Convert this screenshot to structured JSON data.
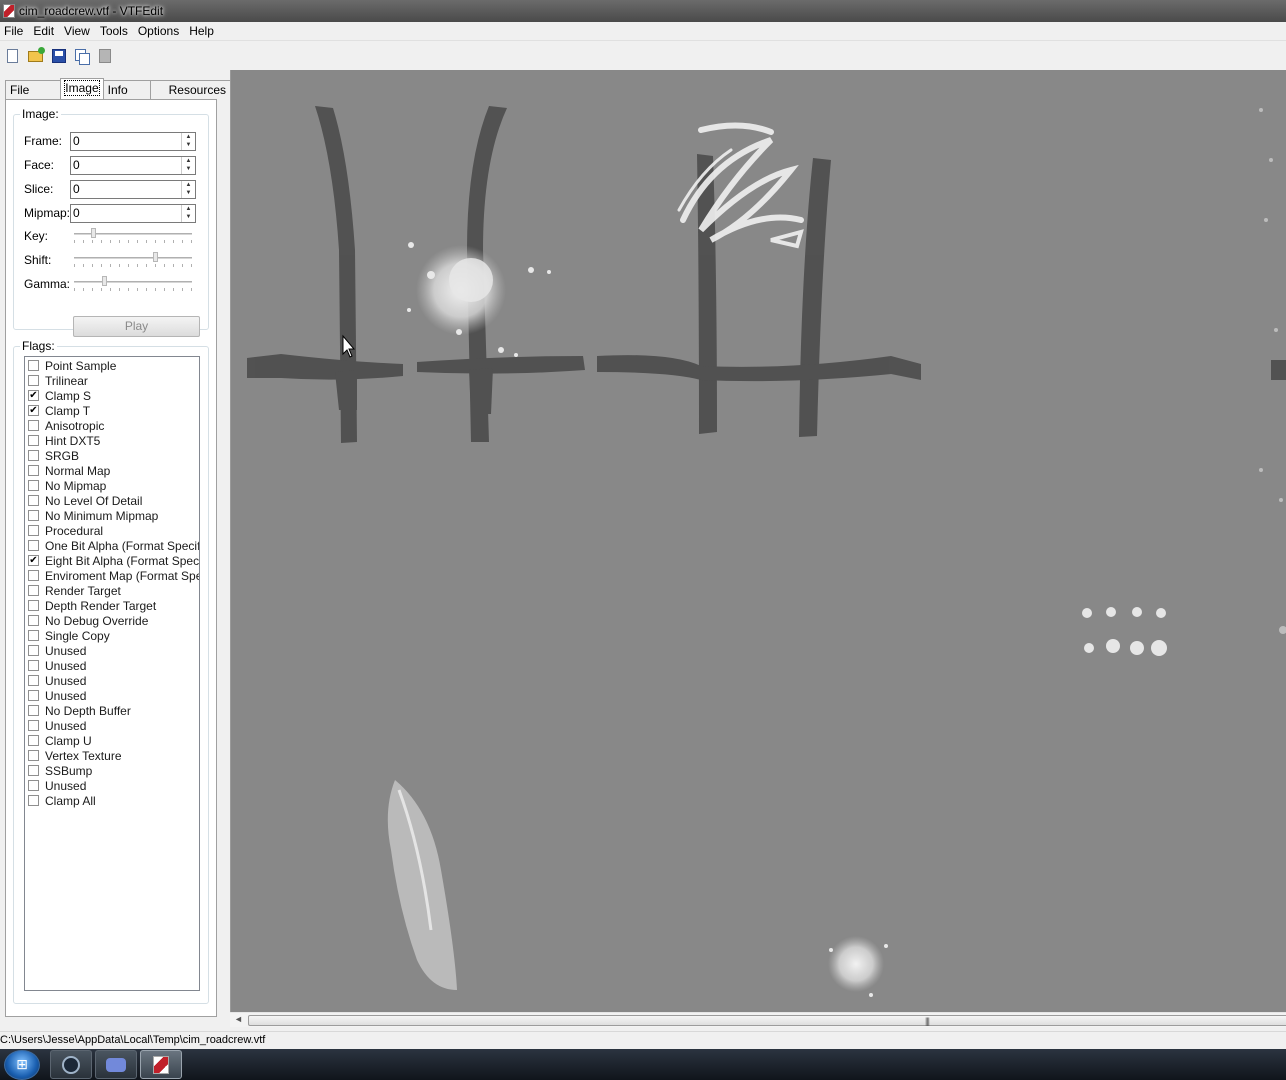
{
  "window": {
    "title": "cim_roadcrew.vtf - VTFEdit"
  },
  "menu": [
    "File",
    "Edit",
    "View",
    "Tools",
    "Options",
    "Help"
  ],
  "toolbar": {
    "icons": [
      "new-file-icon",
      "open-folder-icon",
      "save-disk-icon",
      "copy-icon",
      "paste-icon"
    ]
  },
  "tabs": [
    "File System",
    "Image",
    "Info",
    "Resources"
  ],
  "active_tab": "Image",
  "image_group": {
    "label": "Image:",
    "fields": [
      {
        "label": "Frame:",
        "value": "0"
      },
      {
        "label": "Face:",
        "value": "0"
      },
      {
        "label": "Slice:",
        "value": "0"
      },
      {
        "label": "Mipmap:",
        "value": "0"
      }
    ],
    "sliders": [
      {
        "label": "Key:",
        "value": 0.15
      },
      {
        "label": "Shift:",
        "value": 0.7
      },
      {
        "label": "Gamma:",
        "value": 0.25
      }
    ],
    "play_label": "Play"
  },
  "flags_group": {
    "label": "Flags:",
    "items": [
      {
        "label": "Point Sample",
        "checked": false
      },
      {
        "label": "Trilinear",
        "checked": false
      },
      {
        "label": "Clamp S",
        "checked": true
      },
      {
        "label": "Clamp T",
        "checked": true
      },
      {
        "label": "Anisotropic",
        "checked": false
      },
      {
        "label": "Hint DXT5",
        "checked": false
      },
      {
        "label": "SRGB",
        "checked": false
      },
      {
        "label": "Normal Map",
        "checked": false
      },
      {
        "label": "No Mipmap",
        "checked": false
      },
      {
        "label": "No Level Of Detail",
        "checked": false
      },
      {
        "label": "No Minimum Mipmap",
        "checked": false
      },
      {
        "label": "Procedural",
        "checked": false
      },
      {
        "label": "One Bit Alpha (Format Specifi",
        "checked": false
      },
      {
        "label": "Eight Bit Alpha (Format Specif",
        "checked": true
      },
      {
        "label": "Enviroment Map (Format Spe",
        "checked": false
      },
      {
        "label": "Render Target",
        "checked": false
      },
      {
        "label": "Depth Render Target",
        "checked": false
      },
      {
        "label": "No Debug Override",
        "checked": false
      },
      {
        "label": "Single Copy",
        "checked": false
      },
      {
        "label": "Unused",
        "checked": false
      },
      {
        "label": "Unused",
        "checked": false
      },
      {
        "label": "Unused",
        "checked": false
      },
      {
        "label": "Unused",
        "checked": false
      },
      {
        "label": "No Depth Buffer",
        "checked": false
      },
      {
        "label": "Unused",
        "checked": false
      },
      {
        "label": "Clamp U",
        "checked": false
      },
      {
        "label": "Vertex Texture",
        "checked": false
      },
      {
        "label": "SSBump",
        "checked": false
      },
      {
        "label": "Unused",
        "checked": false
      },
      {
        "label": "Clamp All",
        "checked": false
      }
    ]
  },
  "status": {
    "path": "C:\\Users\\Jesse\\AppData\\Local\\Temp\\cim_roadcrew.vtf"
  },
  "taskbar": {
    "apps": [
      "steam-icon",
      "discord-icon",
      "vtfedit-icon"
    ],
    "active": "vtfedit-icon"
  },
  "colors": {
    "viewport_bg": "#888888",
    "tape": "#4a4a4a",
    "paint": "#e8e8e8"
  }
}
